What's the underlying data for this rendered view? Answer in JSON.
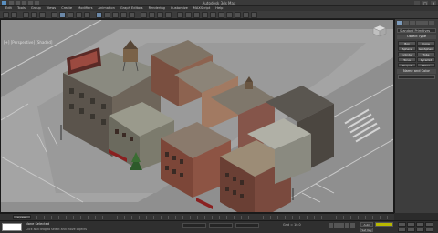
{
  "app": {
    "title": "Autodesk 3ds Max",
    "window_controls": [
      "_",
      "□",
      "×"
    ]
  },
  "menubar": {
    "items": [
      "Edit",
      "Tools",
      "Group",
      "Views",
      "Create",
      "Modifiers",
      "Animation",
      "Graph Editors",
      "Rendering",
      "Customize",
      "MAXScript",
      "Help"
    ]
  },
  "viewport": {
    "label": "[+] [Perspective] [Shaded]"
  },
  "command_panel": {
    "tabs": [
      "create-tab",
      "modify-tab",
      "hierarchy-tab",
      "motion-tab",
      "display-tab",
      "utilities-tab"
    ],
    "category_dropdown": "Standard Primitives",
    "object_type_rollout": "Object Type",
    "primitives": [
      "Box",
      "Cone",
      "Sphere",
      "GeoSphere",
      "Cylinder",
      "Tube",
      "Torus",
      "Pyramid",
      "Teapot",
      "Plane"
    ],
    "name_color_rollout": "Name and Color"
  },
  "timeline": {
    "slider_label": "0 / 100"
  },
  "statusbar": {
    "selection_text": "None Selected",
    "hint_text": "Click and drag to select and move objects",
    "auto_key_label": "Auto Key",
    "set_key_label": "Set Key",
    "grid_text": "Grid = 10.0"
  },
  "colors": {
    "viewport_bg": "#8e8e8e",
    "ui_dark": "#2b2b2b",
    "active_tab": "#7d9bbb",
    "key_filter": "#b8b800"
  }
}
